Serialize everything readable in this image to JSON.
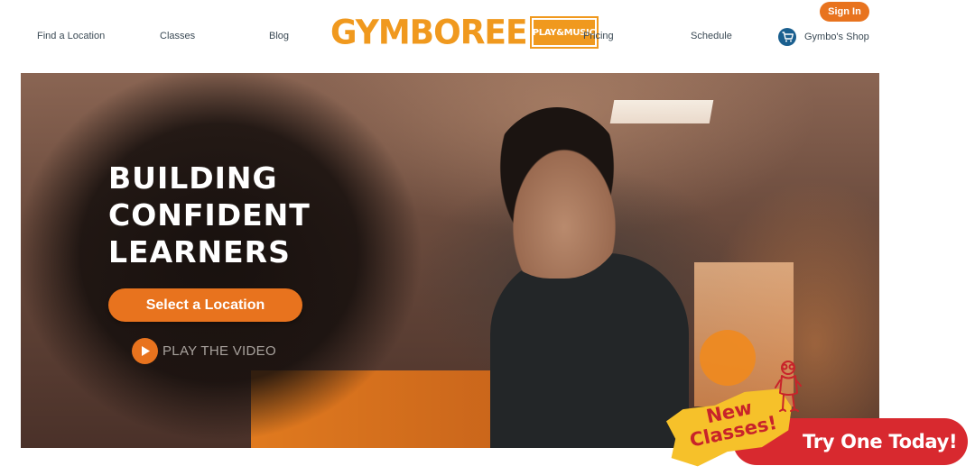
{
  "header": {
    "nav_left": [
      "Find a Location",
      "Classes",
      "Blog"
    ],
    "nav_right": [
      "Pricing",
      "Schedule"
    ],
    "sign_in_label": "Sign In",
    "logo_text": "GYMBOREE",
    "logo_badge": "PLAY&MUSIC",
    "shop_label": "Gymbo's Shop"
  },
  "hero": {
    "headline_lines": [
      "BUILDING",
      "CONFIDENT",
      "LEARNERS"
    ],
    "cta_label": "Select a Location",
    "play_label": "PLAY THE VIDEO"
  },
  "promo": {
    "badge_line1": "New",
    "badge_line2": "Classes!",
    "cta_label": "Try One Today!"
  },
  "colors": {
    "brand_orange": "#e8731e",
    "logo_orange": "#f0991e",
    "promo_red": "#d8292f",
    "promo_yellow": "#f6c12a",
    "shop_blue": "#1a5f8f"
  },
  "icons": {
    "shop": "shopping-cart-icon",
    "play": "play-icon",
    "mascot": "gymbo-mascot-icon"
  }
}
